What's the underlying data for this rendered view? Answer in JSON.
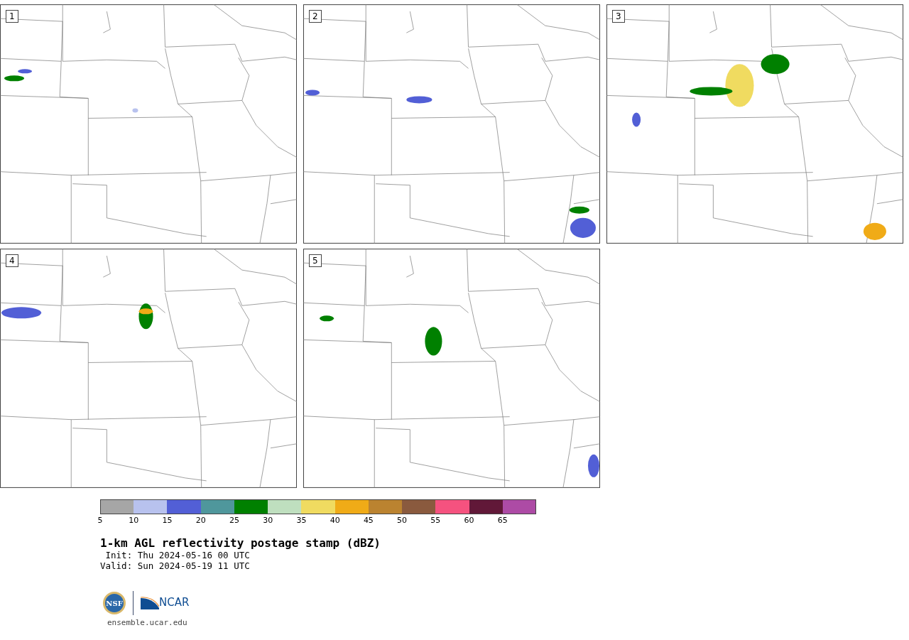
{
  "panels": [
    {
      "label": "1"
    },
    {
      "label": "2"
    },
    {
      "label": "3"
    },
    {
      "label": "4"
    },
    {
      "label": "5"
    }
  ],
  "colorbar": {
    "bins": [
      {
        "tick": "5",
        "color": "#a6a6a6"
      },
      {
        "tick": "10",
        "color": "#b8c2ee"
      },
      {
        "tick": "15",
        "color": "#525fd6"
      },
      {
        "tick": "20",
        "color": "#4f979c"
      },
      {
        "tick": "25",
        "color": "#008000"
      },
      {
        "tick": "30",
        "color": "#bfdfbf"
      },
      {
        "tick": "35",
        "color": "#f0db60"
      },
      {
        "tick": "40",
        "color": "#f0ab17"
      },
      {
        "tick": "45",
        "color": "#bb8330"
      },
      {
        "tick": "50",
        "color": "#8a5a3e"
      },
      {
        "tick": "55",
        "color": "#f5527f"
      },
      {
        "tick": "60",
        "color": "#611838"
      },
      {
        "tick": "65",
        "color": "#ad4ba5"
      }
    ]
  },
  "title": "1-km AGL reflectivity postage stamp (dBZ)",
  "init": " Init: Thu 2024-05-16 00 UTC",
  "valid": "Valid: Sun 2024-05-19 11 UTC",
  "logos": {
    "nsf": "NSF",
    "ncar": "NCAR"
  },
  "site": "ensemble.ucar.edu"
}
